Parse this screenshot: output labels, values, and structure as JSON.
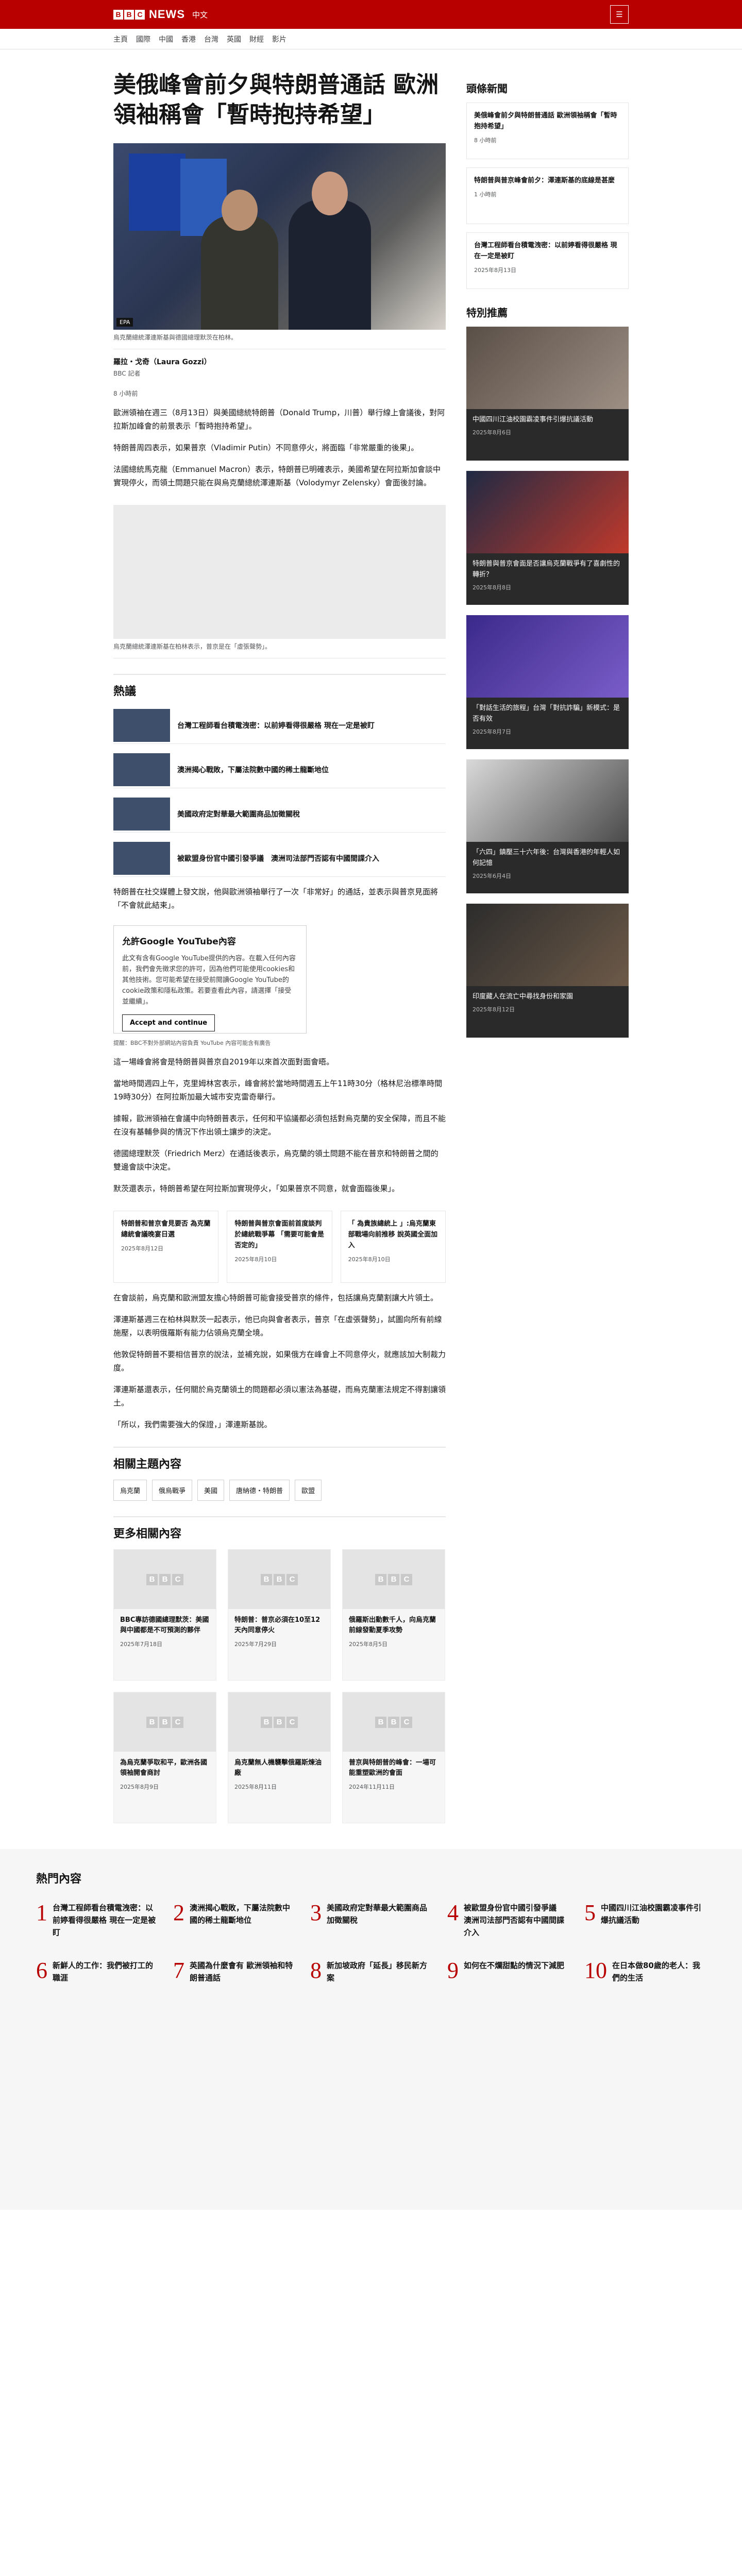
{
  "header": {
    "brand_blocks": [
      "B",
      "B",
      "C"
    ],
    "brand_news": "NEWS",
    "brand_lang": "中文",
    "menu_icon": "menu-icon"
  },
  "nav": {
    "items": [
      "主頁",
      "國際",
      "中國",
      "香港",
      "台灣",
      "英國",
      "財經",
      "影片"
    ]
  },
  "article": {
    "headline": "美俄峰會前夕與特朗普通話 歐洲領袖稱會「暫時抱持希望」",
    "image_badge": "EPA",
    "caption": "烏克蘭總統澤連斯基與德國總理默茨在柏林。",
    "author": "羅拉・戈奇（Laura Gozzi）",
    "org": "BBC 記者",
    "date": "8 小時前",
    "paras": [
      "歐洲領袖在週三（8月13日）與美國總統特朗普（Donald Trump，川普）舉行線上會議後，對阿拉斯加峰會的前景表示「暫時抱持希望」。",
      "特朗普周四表示，如果普京（Vladimir Putin）不同意停火，將面臨「非常嚴重的後果」。",
      "法國總統馬克龍（Emmanuel Macron）表示，特朗普已明確表示，美國希望在阿拉斯加會談中實現停火，而領土問題只能在與烏克蘭總統澤連斯基（Volodymyr Zelensky）會面後討論。"
    ],
    "video_caption": "烏克蘭總統澤連斯基在柏林表示，普京是在「虛張聲勢」。",
    "section_related": "熱議",
    "related": [
      "台灣工程師看台積電洩密：以前婷看得很嚴格 現在一定是被盯",
      "澳洲揭心戰敗，下屬法院數中國的稀土龍斷地位",
      "美國政府定對華最大範圍商品加徵關稅",
      "被歐盟身份官中國引發爭議　澳洲司法部門否認有中國間諜介入"
    ],
    "paras2": [
      "特朗普在社交媒體上發文說，他與歐洲領袖舉行了一次「非常好」的通話，並表示與普京見面將「不會就此結束」。"
    ],
    "yt": {
      "title": "允許Google YouTube內容",
      "body": "此文有含有Google YouTube提供的內容。在載入任何內容前，我們會先徵求您的許可，因為他們可能使用cookies和其他技術。您可能希望在接受前閱讀Google YouTube的cookie政策和隱私政策。若要查看此內容，請選擇「接受並繼續」。",
      "button": "Accept and continue",
      "note": "提醒：BBC不對外部網站內容負責 YouTube 內容可能含有廣告"
    },
    "paras3": [
      "這一場峰會將會是特朗普與普京自2019年以來首次面對面會晤。",
      "當地時間週四上午，克里姆林宮表示，峰會將於當地時間週五上午11時30分（格林尼治標準時間19時30分）在阿拉斯加最大城市安克雷奇舉行。",
      "據報，歐洲領袖在會議中向特朗普表示，任何和平協議都必須包括對烏克蘭的安全保障，而且不能在沒有基輔參與的情況下作出領土讓步的決定。",
      "德國總理默茨（Friedrich Merz）在通話後表示，烏克蘭的領土問題不能在普京和特朗普之間的雙邊會談中決定。",
      "默茨還表示，特朗普希望在阿拉斯加實現停火，「如果普京不同意，就會面臨後果」。"
    ],
    "cards3": [
      {
        "t": "特朗普和普京會見要否 為克蘭總統會議晚宴日選",
        "d": "2025年8月12日"
      },
      {
        "t": "特朗普與普京會面前首度談判於總統戰爭幕 「需要可能會是否定的」",
        "d": "2025年8月10日"
      },
      {
        "t": "「 為貴族總統上 」:烏克蘭東部戰場向前推移 說英國全面加入",
        "d": "2025年8月10日"
      }
    ],
    "paras4": [
      "在會談前，烏克蘭和歐洲盟友擔心特朗普可能會接受普京的條件，包括讓烏克蘭割讓大片領土。",
      "澤連斯基週三在柏林與默茨一起表示，他已向與會者表示，普京「在虛張聲勢」，試圖向所有前線施壓，以表明俄羅斯有能力佔領烏克蘭全境。",
      "他敦促特朗普不要相信普京的說法，並補充說，如果俄方在峰會上不同意停火，就應該加大制裁力度。",
      "澤連斯基還表示，任何關於烏克蘭領土的問題都必須以憲法為基礎，而烏克蘭憲法規定不得割讓領土。",
      "「所以，我們需要強大的保證，」澤連斯基說。"
    ]
  },
  "topics": {
    "title": "相關主題內容",
    "items": [
      "烏克蘭",
      "俄烏戰爭",
      "美國",
      "唐納德・特朗普",
      "歐盟"
    ]
  },
  "more": {
    "title": "更多相關內容",
    "items": [
      {
        "t": "BBC專訪德國總理默茨：美國與中國都是不可預測的夥伴",
        "d": "2025年7月18日"
      },
      {
        "t": "特朗普：普京必須在10至12天內同意停火",
        "d": "2025年7月29日"
      },
      {
        "t": "俄羅斯出動數千人，向烏克蘭前線發動夏季攻勢",
        "d": "2025年8月5日"
      },
      {
        "t": "為烏克蘭爭取和平，歐洲各國領袖開會商討",
        "d": "2025年8月9日"
      },
      {
        "t": "烏克蘭無人機襲擊俄羅斯煉油廠",
        "d": "2025年8月11日"
      },
      {
        "t": "普京與特朗普的峰會：一場可能重塑歐洲的會面",
        "d": "2024年11月11日"
      }
    ]
  },
  "sidebar": {
    "top_title": "頭條新聞",
    "top": [
      {
        "t": "美俄峰會前夕與特朗普通話 歐洲領袖稱會「暫時抱持希望」",
        "d": "8 小時前"
      },
      {
        "t": "特朗普與普京峰會前夕：澤連斯基的底線是甚麼",
        "d": "1 小時前"
      },
      {
        "t": "台灣工程師看台積電洩密：以前婷看得很嚴格 現在一定是被盯",
        "d": "2025年8月13日"
      }
    ],
    "feat_title": "特別推薦",
    "features": [
      {
        "t": "中國四川江油校園霸凌事件引爆抗議活動",
        "d": "2025年8月6日"
      },
      {
        "t": "特朗普與普京會面是否讓烏克蘭戰爭有了喜劇性的轉折？",
        "d": "2025年8月8日"
      },
      {
        "t": "「對話生活的旅程」台灣「對抗詐騙」新模式：是否有效",
        "d": "2025年8月7日"
      },
      {
        "t": "「六四」鎮壓三十六年後：台灣與香港的年輕人如何記憶",
        "d": "2025年6月4日"
      },
      {
        "t": "印度藏人在流亡中尋找身份和家園",
        "d": "2025年8月12日"
      }
    ]
  },
  "popular": {
    "title": "熱門內容",
    "items": [
      "台灣工程師看台積電洩密：以前婷看得很嚴格 現在一定是被盯",
      "澳洲揭心戰敗，下屬法院數中國的稀土龍斷地位",
      "美國政府定對華最大範圍商品加徵關稅",
      "被歐盟身份官中國引發爭議　澳洲司法部門否認有中國間諜介入",
      "中國四川江油校園霸凌事件引爆抗議活動",
      "新鮮人的工作：我們被打工的職涯",
      "英國為什麼會有 歐洲領袖和特朗普通話",
      "新加坡政府「延長」移民新方案",
      "如何在不爛甜點的情況下減肥",
      "在日本做80歲的老人：我們的生活"
    ]
  }
}
